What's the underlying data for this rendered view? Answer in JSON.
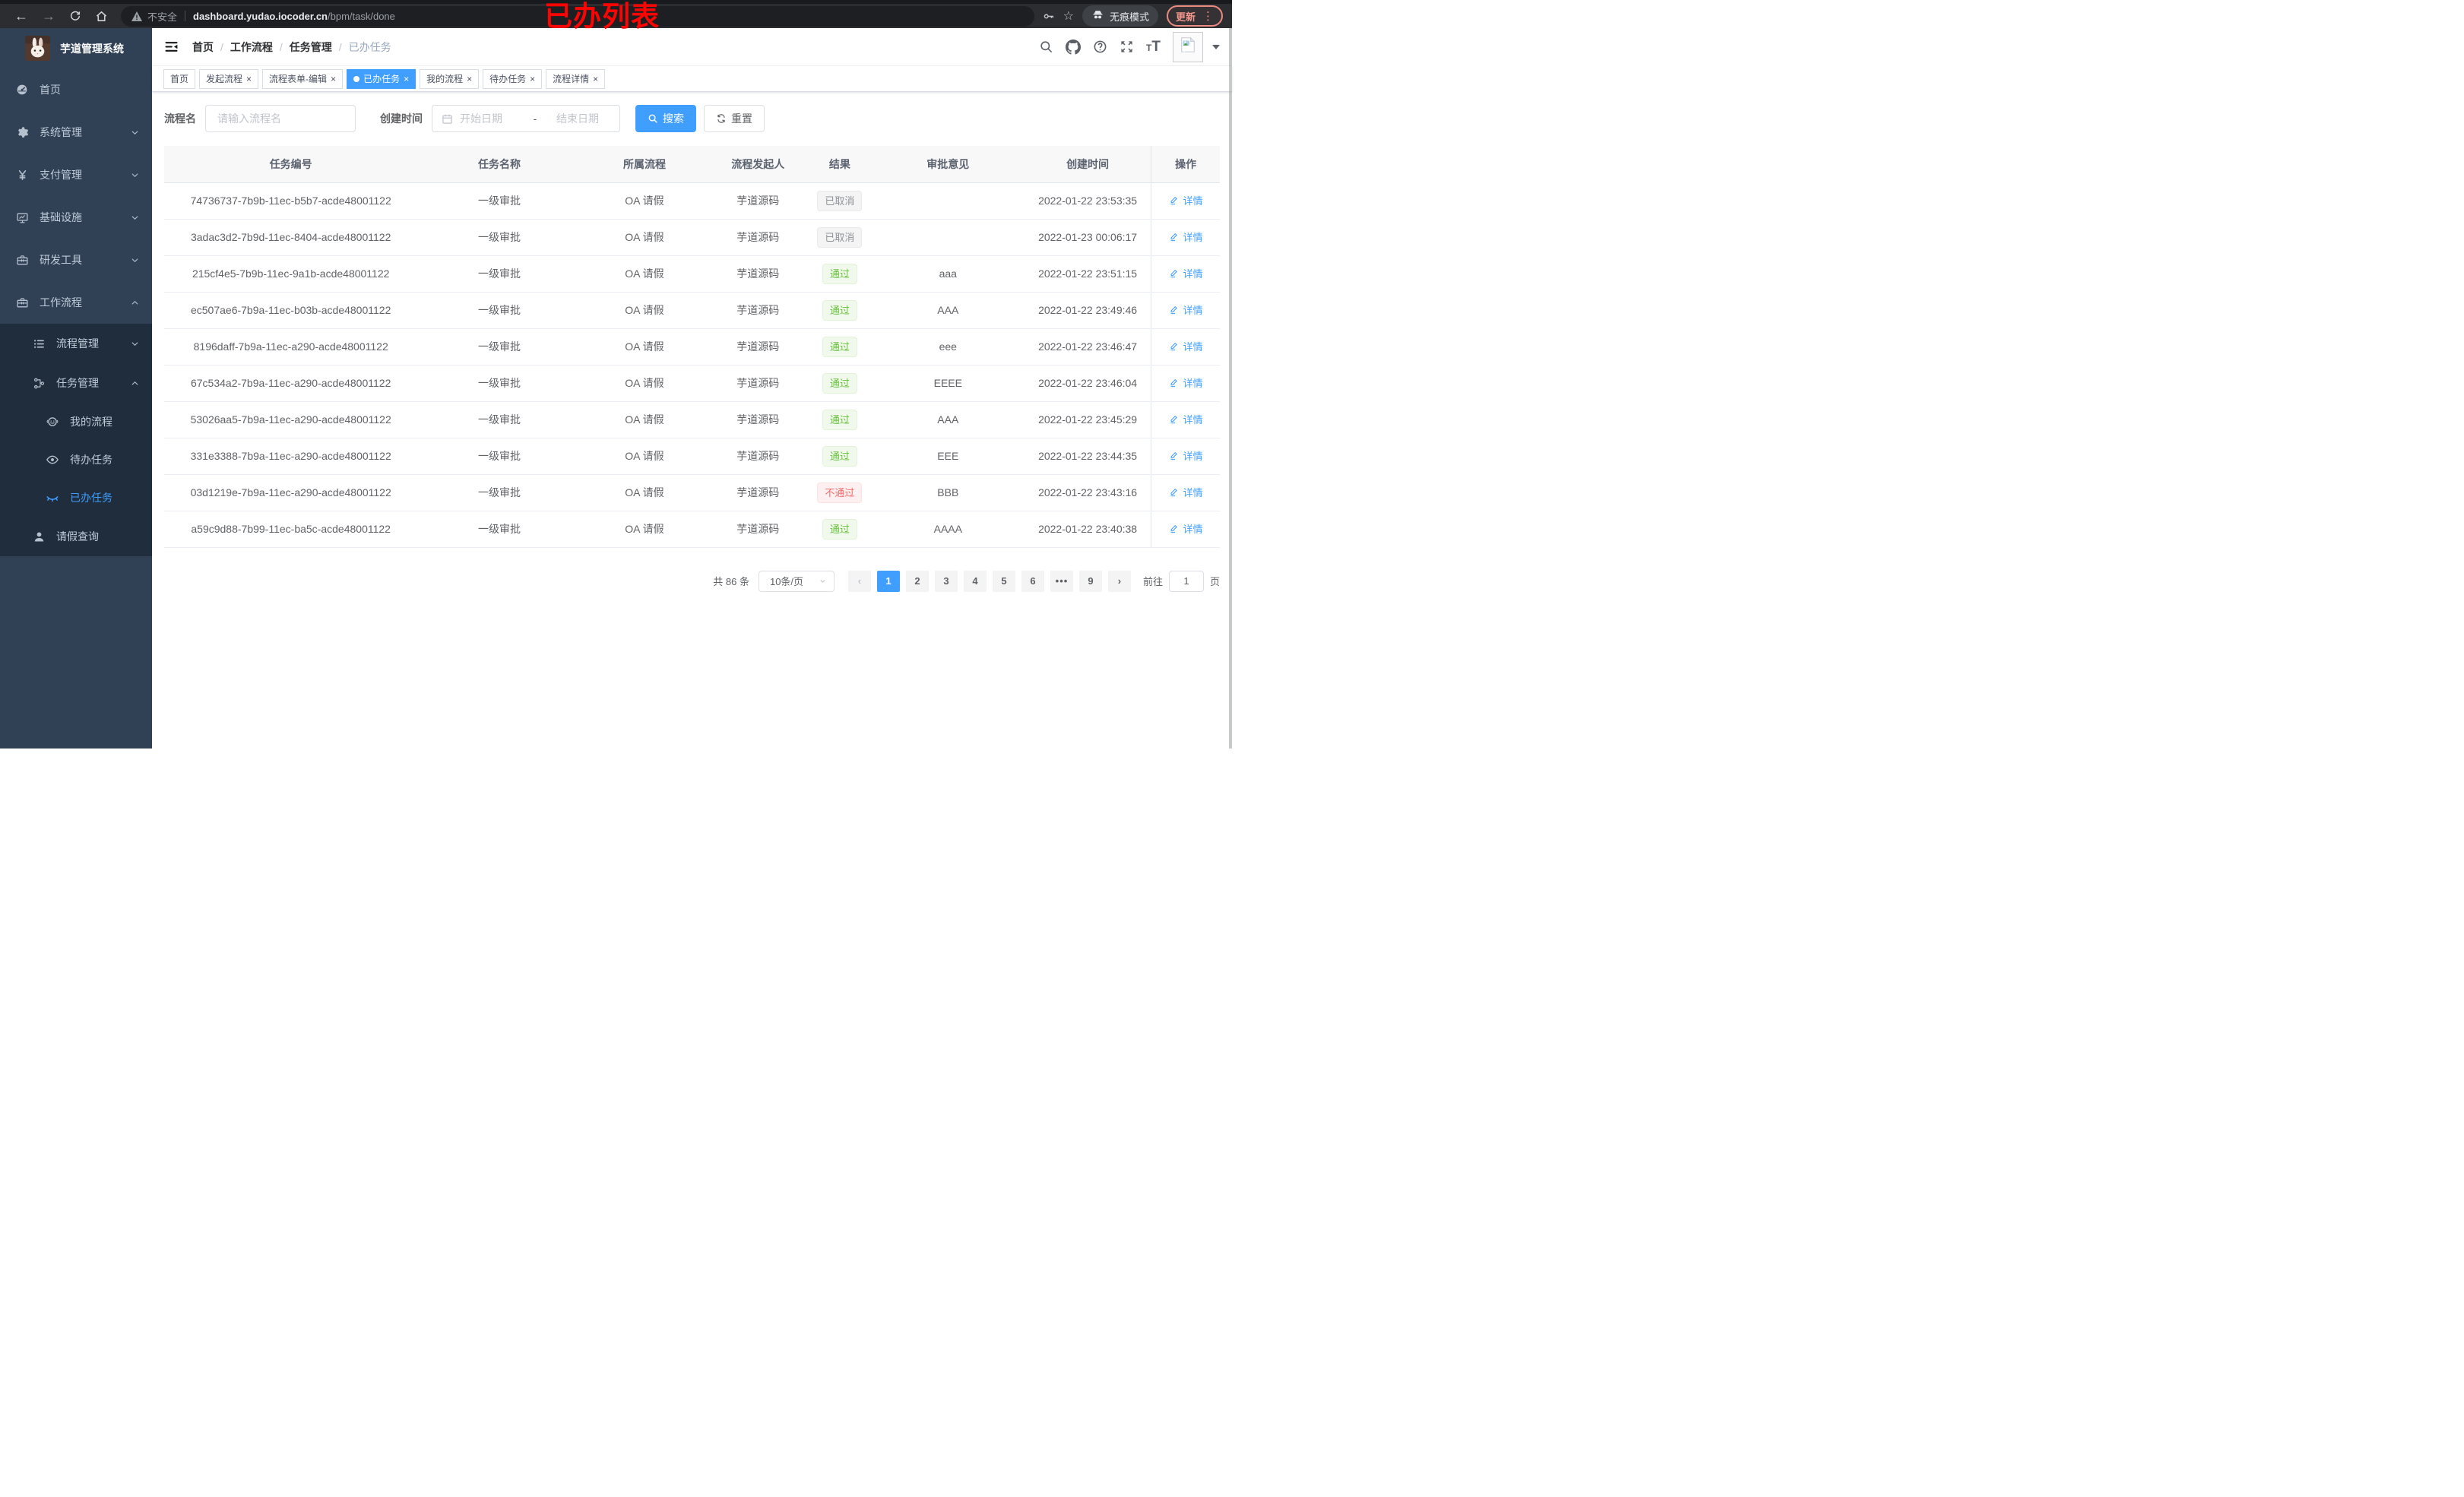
{
  "browser": {
    "security_label": "不安全",
    "url_host": "dashboard.yudao.iocoder.cn",
    "url_path": "/bpm/task/done",
    "incognito_label": "无痕模式",
    "update_label": "更新"
  },
  "annotation_text": "已办列表",
  "sidebar": {
    "logo_title": "芋道管理系统",
    "items": [
      {
        "label": "首页",
        "icon": "dashboard",
        "level": 1
      },
      {
        "label": "系统管理",
        "icon": "gear",
        "level": 1,
        "arrow": "down"
      },
      {
        "label": "支付管理",
        "icon": "yen",
        "level": 1,
        "arrow": "down"
      },
      {
        "label": "基础设施",
        "icon": "monitor",
        "level": 1,
        "arrow": "down"
      },
      {
        "label": "研发工具",
        "icon": "toolbox",
        "level": 1,
        "arrow": "down"
      },
      {
        "label": "工作流程",
        "icon": "briefcase",
        "level": 1,
        "arrow": "up"
      },
      {
        "label": "流程管理",
        "icon": "list",
        "level": 2,
        "arrow": "down",
        "dark": true
      },
      {
        "label": "任务管理",
        "icon": "flow",
        "level": 2,
        "arrow": "up",
        "dark": true
      },
      {
        "label": "我的流程",
        "icon": "face",
        "level": 3,
        "dark": true
      },
      {
        "label": "待办任务",
        "icon": "eye-open",
        "level": 3,
        "dark": true
      },
      {
        "label": "已办任务",
        "icon": "eye-closed",
        "level": 3,
        "dark": true,
        "active": true
      },
      {
        "label": "请假查询",
        "icon": "user",
        "level": 2,
        "dark": true
      }
    ]
  },
  "breadcrumb": {
    "items": [
      "首页",
      "工作流程",
      "任务管理",
      "已办任务"
    ],
    "separator": "/"
  },
  "tabs": [
    {
      "label": "首页"
    },
    {
      "label": "发起流程",
      "closable": true
    },
    {
      "label": "流程表单-编辑",
      "closable": true
    },
    {
      "label": "已办任务",
      "closable": true,
      "active": true
    },
    {
      "label": "我的流程",
      "closable": true
    },
    {
      "label": "待办任务",
      "closable": true
    },
    {
      "label": "流程详情",
      "closable": true
    }
  ],
  "filters": {
    "name_label": "流程名",
    "name_placeholder": "请输入流程名",
    "name_value": "",
    "date_label": "创建时间",
    "date_start_placeholder": "开始日期",
    "date_separator": "-",
    "date_end_placeholder": "结束日期",
    "search_label": "搜索",
    "reset_label": "重置"
  },
  "table": {
    "columns": [
      "任务编号",
      "任务名称",
      "所属流程",
      "流程发起人",
      "结果",
      "审批意见",
      "创建时间",
      "操作"
    ],
    "action_label": "详情",
    "rows": [
      {
        "id": "74736737-7b9b-11ec-b5b7-acde48001122",
        "name": "一级审批",
        "process": "OA 请假",
        "starter": "芋道源码",
        "result": "已取消",
        "result_type": "info",
        "comment": "",
        "created": "2022-01-22 23:53:35"
      },
      {
        "id": "3adac3d2-7b9d-11ec-8404-acde48001122",
        "name": "一级审批",
        "process": "OA 请假",
        "starter": "芋道源码",
        "result": "已取消",
        "result_type": "info",
        "comment": "",
        "created": "2022-01-23 00:06:17"
      },
      {
        "id": "215cf4e5-7b9b-11ec-9a1b-acde48001122",
        "name": "一级审批",
        "process": "OA 请假",
        "starter": "芋道源码",
        "result": "通过",
        "result_type": "success",
        "comment": "aaa",
        "created": "2022-01-22 23:51:15"
      },
      {
        "id": "ec507ae6-7b9a-11ec-b03b-acde48001122",
        "name": "一级审批",
        "process": "OA 请假",
        "starter": "芋道源码",
        "result": "通过",
        "result_type": "success",
        "comment": "AAA",
        "created": "2022-01-22 23:49:46"
      },
      {
        "id": "8196daff-7b9a-11ec-a290-acde48001122",
        "name": "一级审批",
        "process": "OA 请假",
        "starter": "芋道源码",
        "result": "通过",
        "result_type": "success",
        "comment": "eee",
        "created": "2022-01-22 23:46:47"
      },
      {
        "id": "67c534a2-7b9a-11ec-a290-acde48001122",
        "name": "一级审批",
        "process": "OA 请假",
        "starter": "芋道源码",
        "result": "通过",
        "result_type": "success",
        "comment": "EEEE",
        "created": "2022-01-22 23:46:04"
      },
      {
        "id": "53026aa5-7b9a-11ec-a290-acde48001122",
        "name": "一级审批",
        "process": "OA 请假",
        "starter": "芋道源码",
        "result": "通过",
        "result_type": "success",
        "comment": "AAA",
        "created": "2022-01-22 23:45:29"
      },
      {
        "id": "331e3388-7b9a-11ec-a290-acde48001122",
        "name": "一级审批",
        "process": "OA 请假",
        "starter": "芋道源码",
        "result": "通过",
        "result_type": "success",
        "comment": "EEE",
        "created": "2022-01-22 23:44:35"
      },
      {
        "id": "03d1219e-7b9a-11ec-a290-acde48001122",
        "name": "一级审批",
        "process": "OA 请假",
        "starter": "芋道源码",
        "result": "不通过",
        "result_type": "danger",
        "comment": "BBB",
        "created": "2022-01-22 23:43:16"
      },
      {
        "id": "a59c9d88-7b99-11ec-ba5c-acde48001122",
        "name": "一级审批",
        "process": "OA 请假",
        "starter": "芋道源码",
        "result": "通过",
        "result_type": "success",
        "comment": "AAAA",
        "created": "2022-01-22 23:40:38"
      }
    ]
  },
  "pagination": {
    "total_label": "共 86 条",
    "page_size_value": "10条/页",
    "pages": [
      "1",
      "2",
      "3",
      "4",
      "5",
      "6",
      "•••",
      "9"
    ],
    "active_page": "1",
    "prev_disabled": true,
    "goto_label": "前往",
    "goto_value": "1",
    "goto_unit": "页"
  },
  "colors": {
    "accent": "#409eff",
    "sidebar_bg": "#304156",
    "submenu_bg": "#1f2d3d",
    "badge_info_text": "#909399",
    "badge_success_text": "#67c23a",
    "badge_danger_text": "#f56c6c",
    "annotation_red": "#fb0502"
  }
}
